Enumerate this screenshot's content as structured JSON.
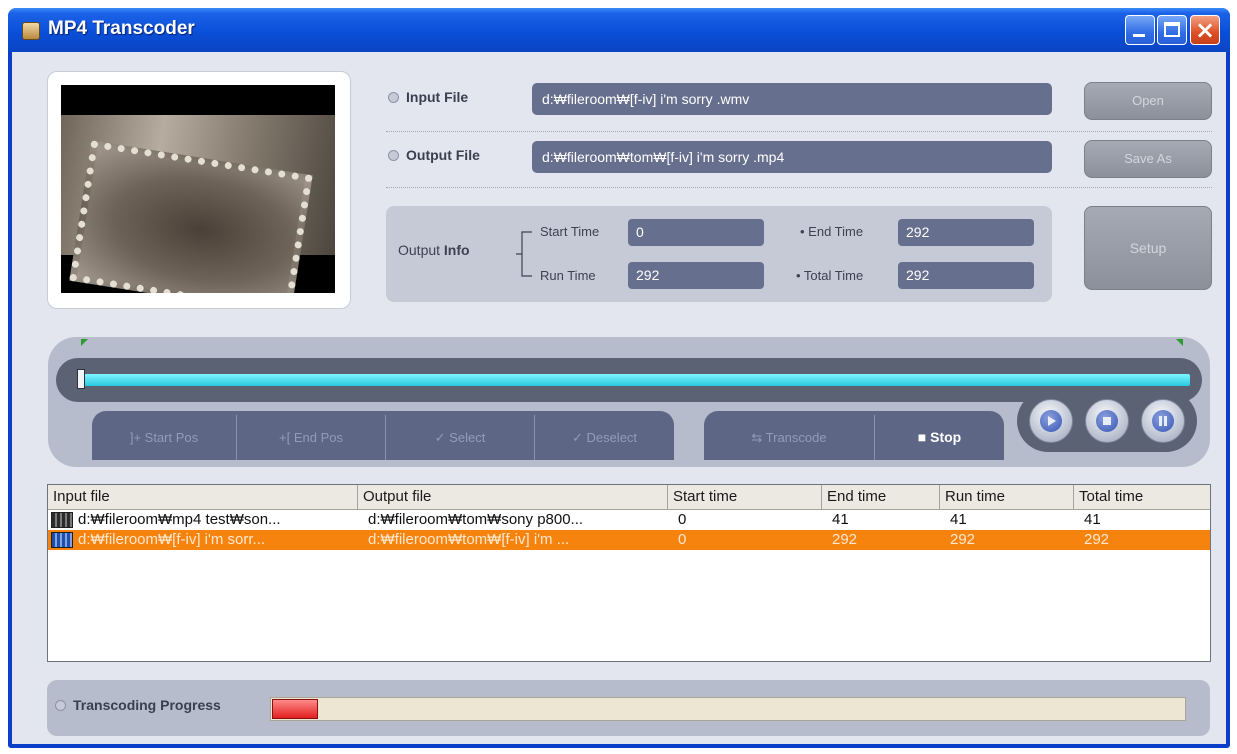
{
  "window": {
    "title": "MP4 Transcoder",
    "icons": {
      "app": "app-icon",
      "minimize": "minimize-icon",
      "maximize": "maximize-icon",
      "close": "close-icon"
    },
    "close_glyph": "×"
  },
  "files": {
    "input_label": "Input File",
    "input_value": "d:₩fileroom₩[f-iv] i'm sorry .wmv",
    "output_label": "Output File",
    "output_value": "d:₩fileroom₩tom₩[f-iv] i'm sorry .mp4",
    "open_label": "Open",
    "save_as_label": "Save As",
    "setup_label": "Setup"
  },
  "output_info": {
    "label_plain": "Output ",
    "label_bold": "Info",
    "start_time_label": "Start Time",
    "start_time": "0",
    "end_time_label": "• End Time",
    "end_time": "292",
    "run_time_label": "Run Time",
    "run_time": "292",
    "total_time_label": "• Total Time",
    "total_time": "292"
  },
  "seek": {
    "position_fraction": 0.0
  },
  "controls": {
    "start_pos": "]+ Start Pos",
    "end_pos": "+[ End Pos",
    "select": "✓ Select",
    "deselect": "✓ Deselect",
    "transcode": "⇆ Transcode",
    "stop": "■  Stop",
    "circle_buttons": [
      "play-icon",
      "stop-icon",
      "pause-icon"
    ]
  },
  "list": {
    "columns": [
      "Input file",
      "Output file",
      "Start time",
      "End time",
      "Run time",
      "Total time"
    ],
    "rows": [
      {
        "input": "d:₩fileroom₩mp4 test₩son...",
        "output": "d:₩fileroom₩tom₩sony p800...",
        "start": "0",
        "end": "41",
        "run": "41",
        "total": "41",
        "selected": false
      },
      {
        "input": "d:₩fileroom₩[f-iv] i'm sorr...",
        "output": "d:₩fileroom₩tom₩[f-iv] i'm ...",
        "start": "0",
        "end": "292",
        "run": "292",
        "total": "292",
        "selected": true
      }
    ]
  },
  "progress": {
    "label": "Transcoding Progress",
    "value_fraction": 0.05
  },
  "colors": {
    "titlebar": "#0a4fd8",
    "field": "#666f8d",
    "selection": "#f7830f",
    "seek_fill": "#29c9e0",
    "progress_fill": "#e32020"
  }
}
